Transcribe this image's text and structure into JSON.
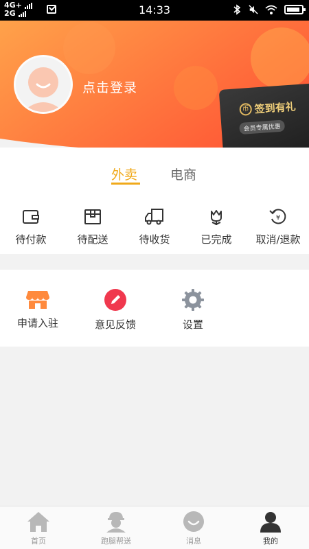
{
  "status_bar": {
    "network_top": "4G+",
    "network_bottom": "2G",
    "time": "14:33"
  },
  "header": {
    "login_text": "点击登录",
    "vip_card_title": "签到有礼",
    "vip_card_subtitle": "会员专属优惠",
    "vip_card_icon_glyph": "币",
    "gradient_colors": [
      "#ffa24a",
      "#ff5a36"
    ]
  },
  "order_tabs": [
    {
      "label": "外卖",
      "active": true
    },
    {
      "label": "电商",
      "active": false
    }
  ],
  "order_status": [
    {
      "label": "待付款",
      "icon": "wallet-icon"
    },
    {
      "label": "待配送",
      "icon": "package-icon"
    },
    {
      "label": "待收货",
      "icon": "delivery-truck-icon"
    },
    {
      "label": "已完成",
      "icon": "flower-icon"
    },
    {
      "label": "取消/退款",
      "icon": "refund-icon"
    }
  ],
  "tools": [
    {
      "label": "申请入驻",
      "icon": "store-icon",
      "color": "#ff8a3d"
    },
    {
      "label": "意见反馈",
      "icon": "pencil-icon",
      "color": "#f0384e"
    },
    {
      "label": "设置",
      "icon": "gear-icon",
      "color": "#8c939d"
    }
  ],
  "bottom_nav": [
    {
      "label": "首页",
      "icon": "home-icon",
      "active": false
    },
    {
      "label": "跑腿帮送",
      "icon": "courier-icon",
      "active": false
    },
    {
      "label": "消息",
      "icon": "message-icon",
      "active": false
    },
    {
      "label": "我的",
      "icon": "profile-icon",
      "active": true
    }
  ],
  "colors": {
    "accent": "#f0a91a",
    "page_background": "#f2f2f2"
  }
}
